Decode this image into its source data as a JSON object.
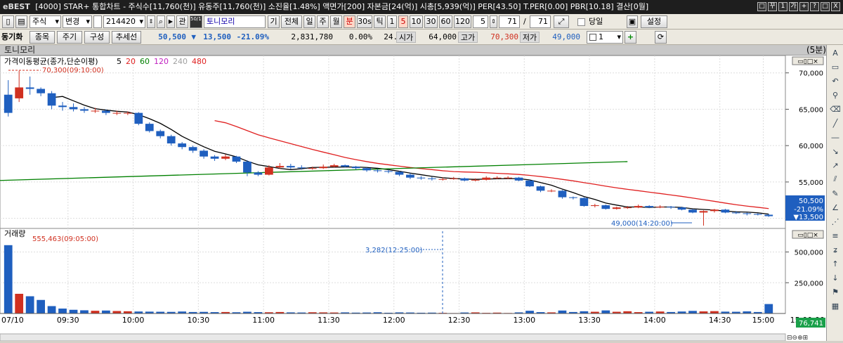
{
  "title_bar": {
    "logo": "eBEST",
    "title": "[4000] STAR+ 통합차트 - 주식수[11,760(천)] 유동주[11,760(천)] 소진율[1.48%] 액면가[200] 자본금[24(억)] 시총[5,939(억)] PER[43.50] T.PER[0.00] PBR[10.18] 결산[0월]",
    "window_buttons": [
      "□",
      "꾸",
      "1",
      "가",
      "+",
      "?",
      "□",
      "X"
    ]
  },
  "toolbar1": {
    "market": "주식",
    "change": "변경",
    "code": "214420",
    "kwan": "관",
    "shares_tag": "50/100",
    "stock_name": "토니모리",
    "period_buttons": [
      "기",
      "전체",
      "일",
      "주",
      "월",
      "분",
      "30s",
      "틱",
      "1",
      "5",
      "10",
      "30",
      "60",
      "120"
    ],
    "selected_period": "분",
    "selected_interval": "5",
    "count_a": "5",
    "count_b": "71",
    "separator": "/",
    "count_c": "71",
    "today_check_label": "당일",
    "settings_label": "설정"
  },
  "toolbar2": {
    "sync_label": "동기화",
    "tab_stock": "종목",
    "tab_period": "주기",
    "tab_config": "구성",
    "tab_trend": "추세선",
    "price": "50,500",
    "change_arrow": "▼",
    "change": "13,500",
    "change_pct": "-21.09%",
    "volume": "2,831,780",
    "ratio1": "0.00%",
    "ratio2": "24.08%",
    "open_label": "시가",
    "open": "64,000",
    "high_label": "고가",
    "high": "70,300",
    "low_label": "저가",
    "low": "49,000",
    "layout_value": "1"
  },
  "chart_header": {
    "name": "토니모리",
    "period": "(5분)"
  },
  "price_panel": {
    "indicator_title": "가격이동평균(종가,단순이평)",
    "ma_periods": [
      "5",
      "20",
      "60",
      "120",
      "240",
      "480"
    ],
    "ma_colors": [
      "#000000",
      "#e02020",
      "#008000",
      "#c020c0",
      "#a0a0a0",
      "#e02020"
    ],
    "high_annotation": "70,300(09:10:00)",
    "low_annotation": "49,000(14:20:00)",
    "y_ticks": [
      "70,000",
      "65,000",
      "60,000",
      "55,000"
    ],
    "current_price_box": [
      "50,500",
      "-21.09%",
      "▼13,500"
    ],
    "up_color": "#d03020",
    "down_color": "#1f5fbf"
  },
  "volume_panel": {
    "title": "거래량",
    "max_annotation": "555,463(09:05:00)",
    "crosshair_label": "3,282(12:25:00)",
    "y_ticks": [
      "500,000",
      "250,000"
    ],
    "last_volume_box": "76,741"
  },
  "x_axis": {
    "labels": [
      "07/10",
      "09:30",
      "10:00",
      "10:30",
      "11:00",
      "11:30",
      "12:00",
      "12:30",
      "13:00",
      "13:30",
      "14:00",
      "14:30",
      "15:00",
      "15:00:00"
    ]
  },
  "chart_data": {
    "type": "candlestick",
    "x": [
      "09:00",
      "09:05",
      "09:10",
      "09:15",
      "09:20",
      "09:25",
      "09:30",
      "09:35",
      "09:40",
      "09:45",
      "09:50",
      "09:55",
      "10:00",
      "10:05",
      "10:10",
      "10:15",
      "10:20",
      "10:25",
      "10:30",
      "10:35",
      "10:40",
      "10:45",
      "10:50",
      "10:55",
      "11:00",
      "11:05",
      "11:10",
      "11:15",
      "11:20",
      "11:25",
      "11:30",
      "11:35",
      "11:40",
      "11:45",
      "11:50",
      "11:55",
      "12:00",
      "12:05",
      "12:10",
      "12:15",
      "12:20",
      "12:25",
      "12:30",
      "12:35",
      "12:40",
      "12:45",
      "12:50",
      "12:55",
      "13:00",
      "13:05",
      "13:10",
      "13:15",
      "13:20",
      "13:25",
      "13:30",
      "13:35",
      "13:40",
      "13:45",
      "13:50",
      "13:55",
      "14:00",
      "14:05",
      "14:10",
      "14:15",
      "14:20",
      "14:25",
      "14:30",
      "14:35",
      "14:40",
      "14:45",
      "14:50"
    ],
    "open": [
      67000,
      66500,
      68000,
      67800,
      67200,
      65500,
      65300,
      65000,
      64800,
      64800,
      64500,
      64500,
      64500,
      63000,
      62000,
      61300,
      60300,
      59800,
      59300,
      58500,
      58200,
      58500,
      57800,
      56300,
      56000,
      57000,
      57200,
      57000,
      56900,
      56900,
      57100,
      57300,
      57100,
      56900,
      56600,
      56500,
      56400,
      56000,
      55600,
      55500,
      55400,
      55400,
      55500,
      55200,
      55300,
      55600,
      55600,
      55600,
      55200,
      54400,
      53800,
      53800,
      52900,
      52800,
      51700,
      51800,
      51300,
      51500,
      51500,
      51700,
      51500,
      51600,
      51500,
      51200,
      50800,
      51000,
      51200,
      50800,
      50700,
      50600,
      50500
    ],
    "close": [
      64500,
      68000,
      67800,
      67200,
      65500,
      65300,
      65000,
      64800,
      64800,
      64500,
      64500,
      64500,
      63000,
      62000,
      61300,
      60300,
      59800,
      59300,
      58500,
      58200,
      58500,
      57800,
      56300,
      56000,
      57000,
      57200,
      57000,
      56900,
      56900,
      57100,
      57300,
      57100,
      56900,
      56600,
      56500,
      56400,
      56000,
      55600,
      55500,
      55400,
      55400,
      55500,
      55200,
      55300,
      55600,
      55600,
      55600,
      55200,
      54400,
      53800,
      53800,
      52900,
      52800,
      51700,
      51800,
      51300,
      51500,
      51500,
      51700,
      51500,
      51600,
      51500,
      51200,
      50800,
      51000,
      51200,
      50800,
      50700,
      50600,
      50500,
      50300
    ],
    "high": [
      69000,
      70300,
      69500,
      68000,
      67500,
      66000,
      65800,
      65300,
      65200,
      65000,
      64800,
      64700,
      64600,
      63200,
      62200,
      61500,
      60500,
      60000,
      59500,
      58700,
      58800,
      58600,
      58000,
      56500,
      57300,
      57600,
      57500,
      57300,
      57100,
      57400,
      57500,
      57400,
      57200,
      57000,
      56800,
      56700,
      56500,
      56200,
      55800,
      55700,
      55600,
      55700,
      55600,
      55500,
      55800,
      55800,
      55800,
      55700,
      55300,
      54500,
      54000,
      53900,
      53000,
      52900,
      52000,
      51900,
      51600,
      51700,
      51900,
      51800,
      51800,
      51700,
      51600,
      51300,
      51100,
      51300,
      51300,
      51000,
      50800,
      50700,
      50600
    ],
    "low": [
      64000,
      66000,
      67000,
      66800,
      65000,
      64800,
      64700,
      64500,
      64500,
      64200,
      64200,
      64200,
      62800,
      61800,
      61000,
      60000,
      59500,
      59000,
      58200,
      57900,
      58000,
      57600,
      55800,
      55800,
      55900,
      56800,
      56800,
      56700,
      56700,
      56800,
      57000,
      57000,
      56700,
      56400,
      56300,
      56200,
      55800,
      55400,
      55300,
      55200,
      55200,
      55300,
      55100,
      55100,
      55200,
      55400,
      55400,
      55100,
      54300,
      53600,
      53600,
      52700,
      52600,
      51600,
      51500,
      51200,
      51200,
      51300,
      51400,
      51400,
      51400,
      51300,
      51100,
      50700,
      49000,
      50800,
      50700,
      50600,
      50400,
      50400,
      50200
    ],
    "volume": [
      555463,
      160000,
      140000,
      110000,
      60000,
      40000,
      30000,
      26000,
      22000,
      24000,
      20000,
      18000,
      16000,
      15000,
      14000,
      13000,
      16000,
      12000,
      13000,
      11000,
      12000,
      10000,
      14000,
      11000,
      10000,
      12000,
      9000,
      8000,
      10000,
      9000,
      8000,
      9000,
      7000,
      8000,
      10000,
      6000,
      9000,
      8000,
      6000,
      7000,
      5000,
      3282,
      8000,
      9000,
      5000,
      7000,
      4000,
      9000,
      22000,
      11000,
      9000,
      24000,
      12000,
      18000,
      14000,
      25000,
      14000,
      18000,
      11000,
      14000,
      16000,
      12000,
      16000,
      21000,
      17000,
      19000,
      15000,
      14000,
      17000,
      12000,
      76741
    ],
    "ma20_start_index": 19,
    "ma60_level": [
      57800,
      55200
    ],
    "ma60_x_range": [
      "13:45",
      "14:55"
    ],
    "ylim": [
      49000,
      72000
    ],
    "volume_ylim": [
      0,
      600000
    ]
  }
}
